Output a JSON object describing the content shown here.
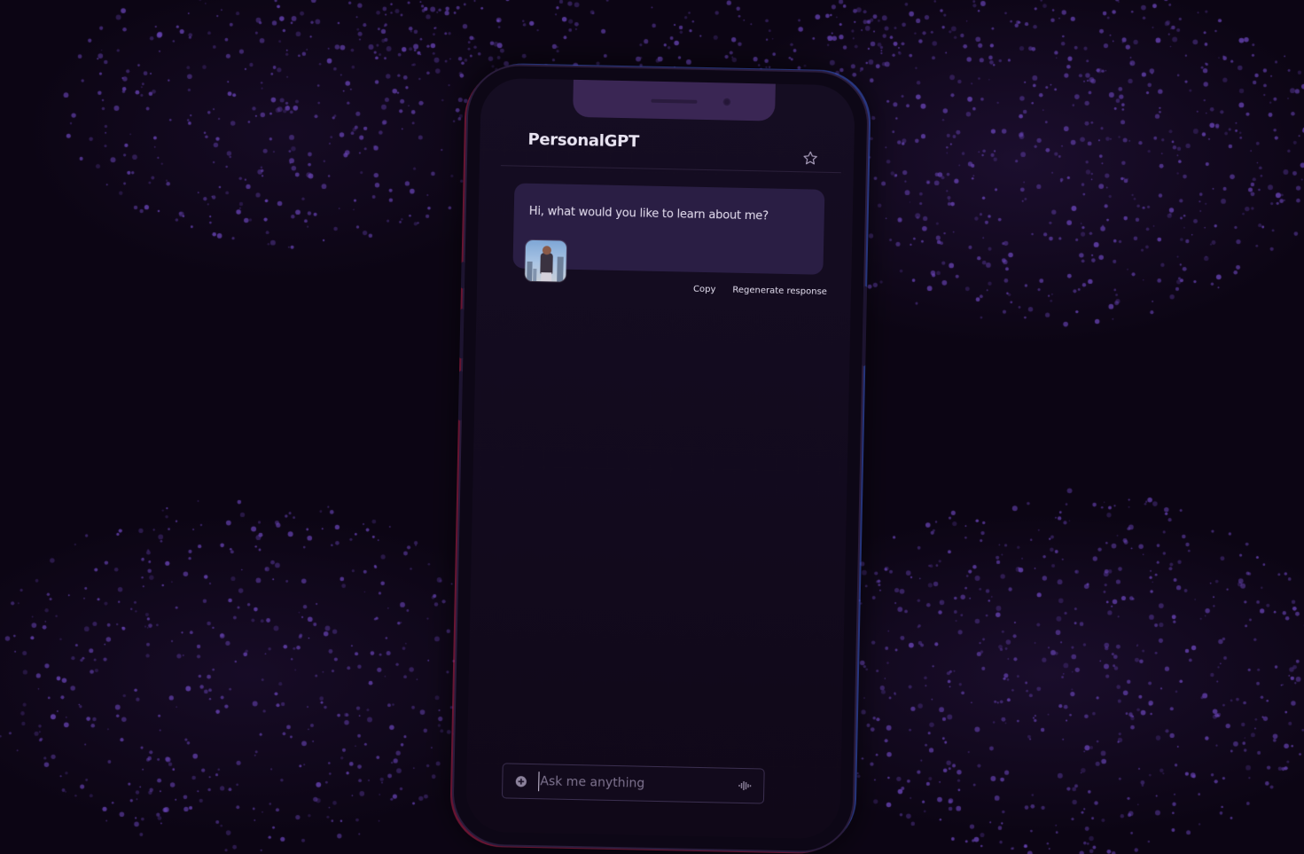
{
  "app": {
    "title": "PersonalGPT"
  },
  "chat": {
    "messages": [
      {
        "role": "assistant",
        "text": "Hi, what would you like to learn about me?",
        "actions": [
          "Copy",
          "Regenerate response"
        ]
      }
    ]
  },
  "composer": {
    "placeholder": "Ask me anything"
  },
  "icons": {
    "header_right": "star-icon",
    "composer_left": "plus-circle-icon",
    "composer_right": "voice-waveform-icon"
  },
  "colors": {
    "background": "#0c0514",
    "bubble": "#2a1e44",
    "particles": "#6a45b8",
    "notch": "#3a2654"
  }
}
